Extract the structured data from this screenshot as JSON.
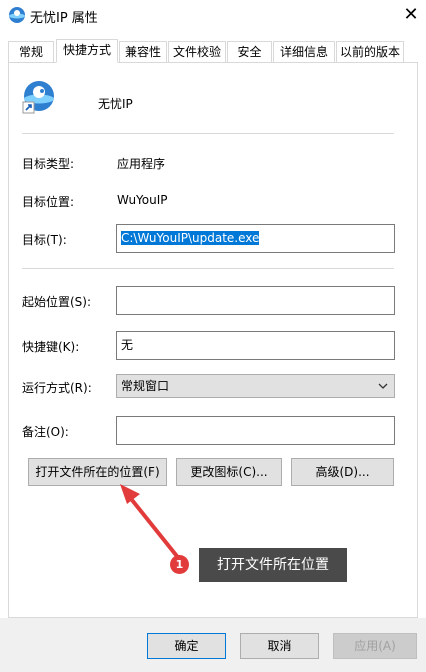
{
  "window": {
    "title": "无忧IP 属性",
    "close_glyph": "✕"
  },
  "tabs": [
    {
      "label": "常规"
    },
    {
      "label": "快捷方式"
    },
    {
      "label": "兼容性"
    },
    {
      "label": "文件校验"
    },
    {
      "label": "安全"
    },
    {
      "label": "详细信息"
    },
    {
      "label": "以前的版本"
    }
  ],
  "shortcut": {
    "app_name": "无忧IP",
    "target_type_label": "目标类型:",
    "target_type_value": "应用程序",
    "target_location_label": "目标位置:",
    "target_location_value": "WuYouIP",
    "target_label": "目标(T):",
    "target_value": "C:\\WuYouIP\\update.exe",
    "start_in_label": "起始位置(S):",
    "start_in_value": "",
    "hotkey_label": "快捷键(K):",
    "hotkey_value": "无",
    "run_label": "运行方式(R):",
    "run_value": "常规窗口",
    "comment_label": "备注(O):",
    "comment_value": "",
    "open_location_button": "打开文件所在的位置(F)",
    "change_icon_button": "更改图标(C)...",
    "advanced_button": "高级(D)..."
  },
  "annotation": {
    "badge": "1",
    "text": "打开文件所在位置"
  },
  "footer": {
    "ok": "确定",
    "cancel": "取消",
    "apply": "应用(A)"
  },
  "colors": {
    "selection": "#0078d7",
    "annotation_red": "#e23b3b",
    "callout_bg": "#4a4a4a"
  }
}
